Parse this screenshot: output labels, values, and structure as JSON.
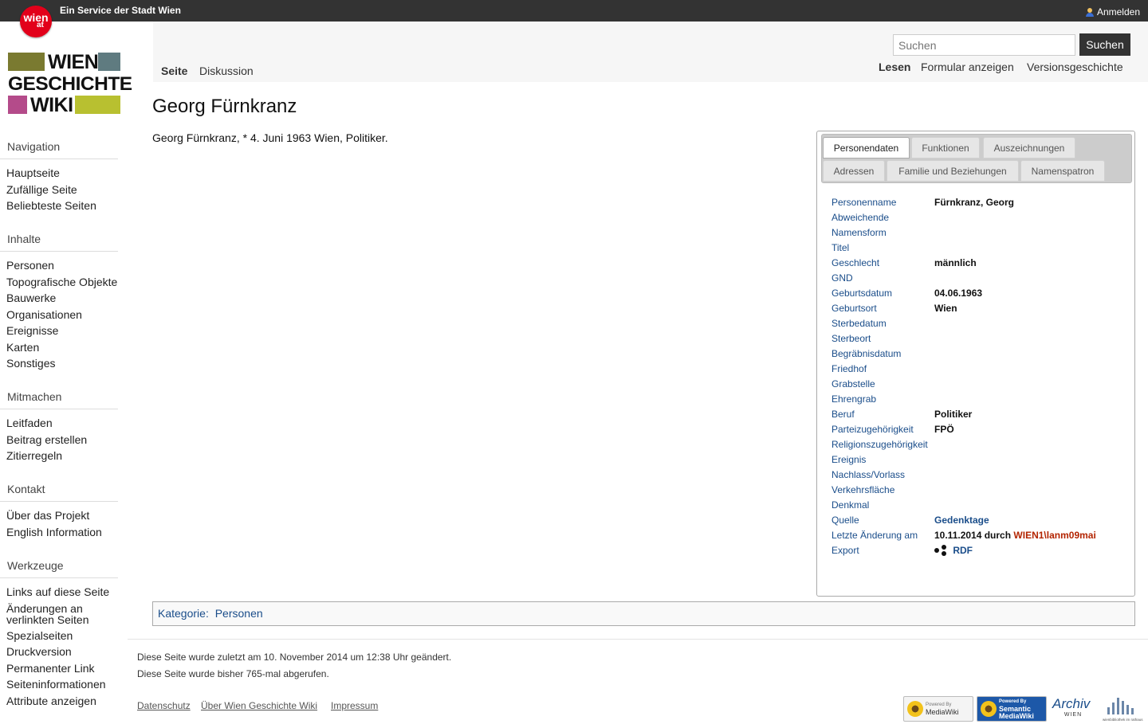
{
  "topbar": {
    "service": "Ein Service der Stadt Wien",
    "badge_main": "wien",
    "badge_at": "at",
    "login": "Anmelden"
  },
  "logo": {
    "line1": "WIEN",
    "line2": "GESCHICHTE",
    "line3": "WIKI",
    "colors": [
      "#7a7a30",
      "#5f7b80",
      "#b44b8a",
      "#b8c030"
    ]
  },
  "sidebar": {
    "sections": [
      {
        "title": "Navigation",
        "items": [
          "Hauptseite",
          "Zufällige Seite",
          "Beliebteste Seiten"
        ]
      },
      {
        "title": "Inhalte",
        "items": [
          "Personen",
          "Topografische Objekte",
          "Bauwerke",
          "Organisationen",
          "Ereignisse",
          "Karten",
          "Sonstiges"
        ]
      },
      {
        "title": "Mitmachen",
        "items": [
          "Leitfaden",
          "Beitrag erstellen",
          "Zitierregeln"
        ]
      },
      {
        "title": "Kontakt",
        "items": [
          "Über das Projekt",
          "English Information"
        ]
      },
      {
        "title": "Werkzeuge",
        "items": [
          "Links auf diese Seite",
          "Änderungen an verlinkten Seiten",
          "Spezialseiten",
          "Druckversion",
          "Permanenter Link",
          "Seiteninformationen",
          "Attribute anzeigen"
        ]
      }
    ]
  },
  "header": {
    "search_placeholder": "Suchen",
    "search_button": "Suchen",
    "tabs_left": [
      "Seite",
      "Diskussion"
    ],
    "tabs_right": [
      "Lesen",
      "Formular anzeigen",
      "Versionsgeschichte"
    ]
  },
  "page": {
    "title": "Georg Fürnkranz",
    "lead": "Georg Fürnkranz, * 4. Juni 1963 Wien, Politiker."
  },
  "infobox": {
    "tabs_row1": [
      "Personendaten",
      "Funktionen",
      "Auszeichnungen"
    ],
    "tabs_row2": [
      "Adressen",
      "Familie und Beziehungen",
      "Namenspatron"
    ],
    "rows": [
      {
        "label": "Personenname",
        "value": "Fürnkranz, Georg"
      },
      {
        "label": "Abweichende",
        "value": ""
      },
      {
        "label": "Namensform",
        "value": ""
      },
      {
        "label": "Titel",
        "value": ""
      },
      {
        "label": "Geschlecht",
        "value": "männlich"
      },
      {
        "label": "GND",
        "value": ""
      },
      {
        "label": "Geburtsdatum",
        "value": "04.06.1963"
      },
      {
        "label": "Geburtsort",
        "value": "Wien"
      },
      {
        "label": "Sterbedatum",
        "value": ""
      },
      {
        "label": "Sterbeort",
        "value": ""
      },
      {
        "label": "Begräbnisdatum",
        "value": ""
      },
      {
        "label": "Friedhof",
        "value": ""
      },
      {
        "label": "Grabstelle",
        "value": ""
      },
      {
        "label": "Ehrengrab",
        "value": ""
      },
      {
        "label": "Beruf",
        "value": "Politiker"
      },
      {
        "label": "Parteizugehörigkeit",
        "value": "FPÖ"
      },
      {
        "label": "Religionszugehörigkeit",
        "value": ""
      },
      {
        "label": "Ereignis",
        "value": ""
      },
      {
        "label": "Nachlass/Vorlass",
        "value": ""
      },
      {
        "label": "Verkehrsfläche",
        "value": ""
      },
      {
        "label": "Denkmal",
        "value": ""
      },
      {
        "label": "Quelle",
        "value": "Gedenktage"
      },
      {
        "label": "Letzte Änderung am",
        "value": ""
      },
      {
        "label": "Export",
        "value": ""
      }
    ],
    "last_change_date": "10.11.2014 durch",
    "last_change_user": "WIEN1\\lanm09mai",
    "export_link": "RDF"
  },
  "category": {
    "label": "Kategorie",
    "value": "Personen"
  },
  "footer": {
    "line1": "Diese Seite wurde zuletzt am 10. November 2014 um 12:38 Uhr geändert.",
    "line2": "Diese Seite wurde bisher 765-mal abgerufen.",
    "links": [
      "Datenschutz",
      "Über Wien Geschichte Wiki",
      "Impressum"
    ],
    "badge_mw_top": "Powered By",
    "badge_mw": "MediaWiki",
    "badge_smw_top": "Powered By",
    "badge_smw_1": "Semantic",
    "badge_smw_2": "MediaWiki",
    "archiv": "Archiv",
    "archiv_sub": "WIEN",
    "library": "wienbibliothek im rathaus"
  }
}
